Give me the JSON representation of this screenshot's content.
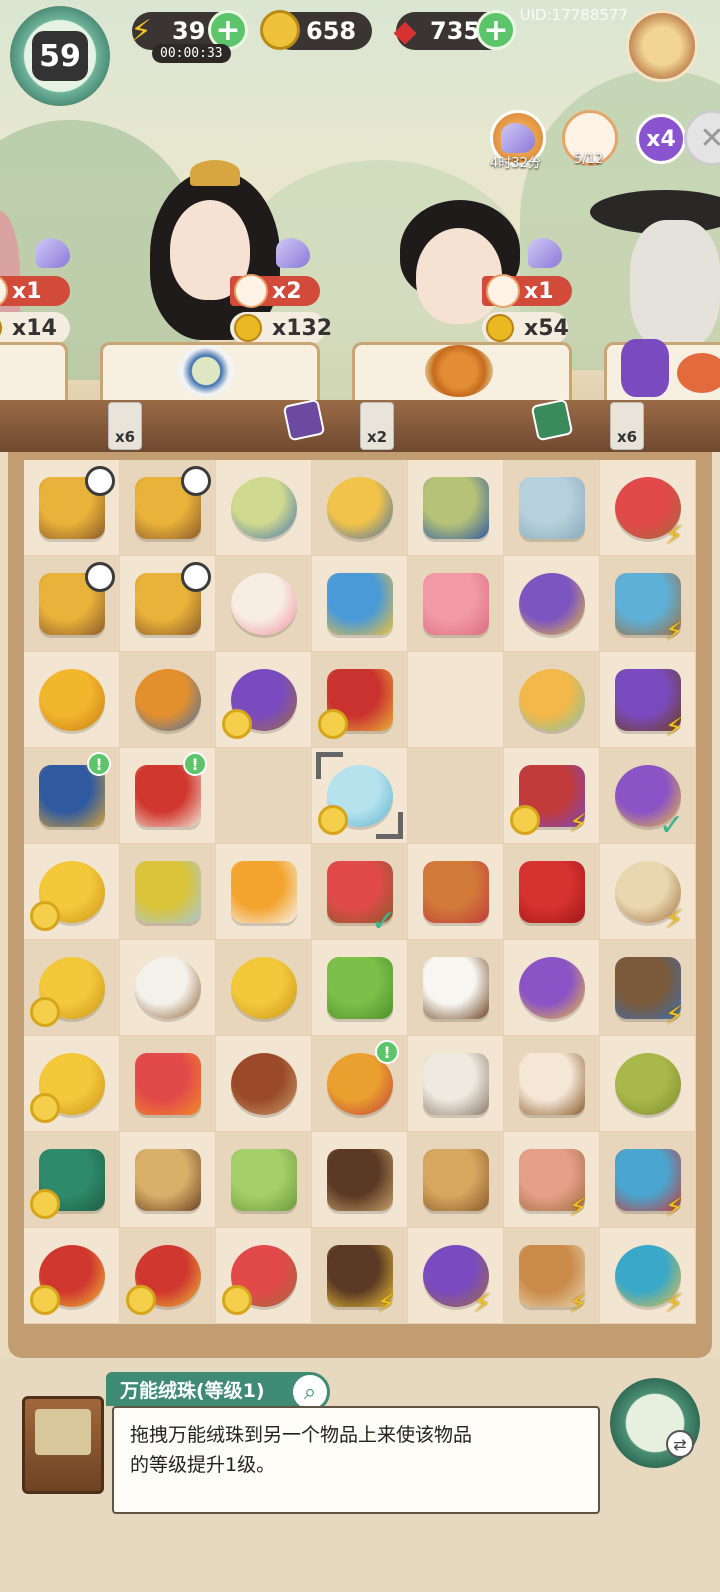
{
  "hud": {
    "level": "59",
    "energy": "39",
    "energy_timer": "00:00:33",
    "coins": "658",
    "gems": "735",
    "uid": "UID:17788577"
  },
  "events": {
    "slipper_timer": "4时32分",
    "cat_progress": "5/12",
    "multiplier": "x4"
  },
  "customers": [
    {
      "cat": "x1",
      "coins": "x14"
    },
    {
      "cat": "x2",
      "coins": "x132"
    },
    {
      "cat": "x1",
      "coins": "x54"
    }
  ],
  "counter_tags": [
    "x6",
    "x2",
    "x6"
  ],
  "board": {
    "rows": [
      [
        "chicken-nest-timer-icon",
        "chicken-nest-timer-icon",
        "tea-bowl-icon",
        "tea-cup-icon",
        "tea-set-icon",
        "feather-icon",
        "watermelon-basket-icon"
      ],
      [
        "chicken-nest-timer-icon",
        "chicken-nest-timer-icon",
        "bun-icon",
        "bead-bracelet-icon",
        "pink-soap-icon",
        "purple-vase-icon",
        "blue-teapot-icon"
      ],
      [
        "gold-vase-icon",
        "noodle-bowl-icon",
        "fabric-basket-icon",
        "feast-box-icon",
        "",
        "donut-dish-icon",
        "cloth-roll-icon"
      ],
      [
        "blue-box-icon",
        "red-round-box-icon",
        "",
        "magic-pearl-icon",
        "",
        "gift-box-icon",
        "purple-pouch-icon"
      ],
      [
        "coin-stack-icon",
        "corn-rice-icon",
        "egg-rice-icon",
        "watermelon-board-icon",
        "lantern-icon",
        "ruby-icon",
        "scroll-basket-icon"
      ],
      [
        "coin-stack-icon",
        "cotton-bowl-icon",
        "two-coins-icon",
        "bamboo-icon",
        "salt-box-icon",
        "purple-pouch-icon",
        "treasure-chest-icon"
      ],
      [
        "coin-stack-icon",
        "fruit-board-icon",
        "cinnamon-bundle-icon",
        "gold-sack-icon",
        "silk-cocoon-icon",
        "yarn-spindle-icon",
        "woven-basket-icon"
      ],
      [
        "jade-box-icon",
        "brush-icon",
        "bamboo-slices-icon",
        "wooden-chest-icon",
        "tea-crate-icon",
        "fruit-crate-icon",
        "teapot-set-icon"
      ],
      [
        "red-vase-icon",
        "red-vase-icon",
        "fruit-basket-icon",
        "open-chest-icon",
        "thread-spool-icon",
        "tool-box-icon",
        "teapot-cup-icon"
      ]
    ]
  },
  "info": {
    "title": "万能绒珠(等级1)",
    "line1": "拖拽万能绒珠到另一个物品上来使该物品",
    "line2": "的等级提升1级。"
  },
  "colors": {
    "accent_green": "#3f8b73",
    "energy_yellow": "#f1c321",
    "gem_red": "#d6322f"
  }
}
